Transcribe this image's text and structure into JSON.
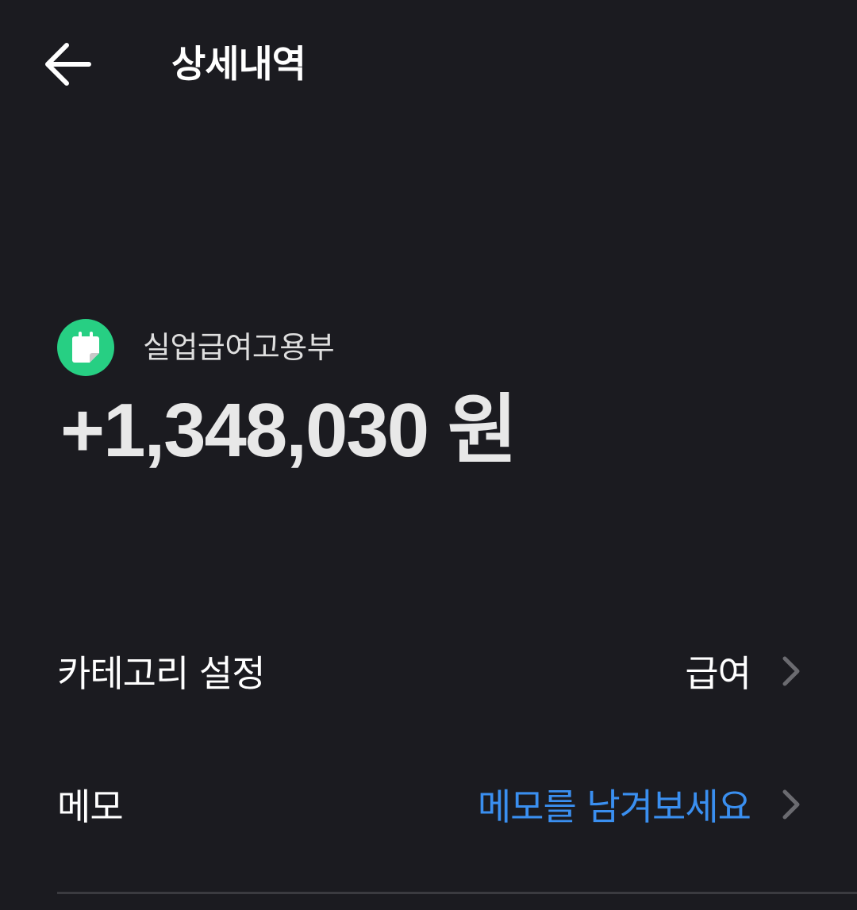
{
  "header": {
    "title": "상세내역",
    "back_icon": "arrow-left-icon"
  },
  "transaction": {
    "merchant": "실업급여고용부",
    "merchant_icon": "calendar-note-icon",
    "merchant_icon_color": "#27cf83",
    "amount": "+1,348,030 원"
  },
  "rows": {
    "category": {
      "label": "카테고리 설정",
      "value": "급여"
    },
    "memo": {
      "label": "메모",
      "value": "메모를 남겨보세요",
      "value_color": "#3a8ff0"
    }
  },
  "colors": {
    "background": "#1b1b20",
    "chevron": "#6b6b70",
    "divider": "#3b3b40"
  }
}
